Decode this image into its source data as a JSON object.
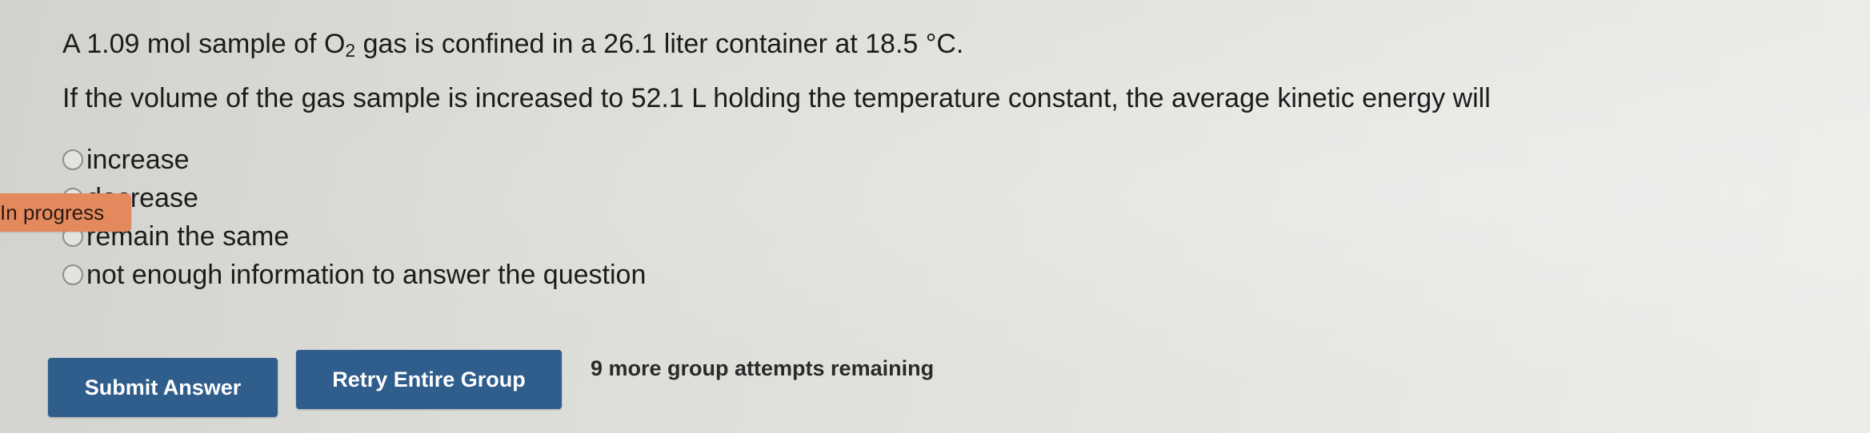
{
  "question": {
    "line1_prefix": "A 1.09 mol sample of O",
    "line1_subscript": "2",
    "line1_suffix": " gas is confined in a 26.1 liter container at 18.5 °C.",
    "line2": "If the volume of the gas sample is increased to 52.1 L holding the temperature constant, the average kinetic energy will"
  },
  "options": [
    {
      "label": "increase"
    },
    {
      "label": "decrease"
    },
    {
      "label": "remain the same"
    },
    {
      "label": "not enough information to answer the question"
    }
  ],
  "progress_badge": "In progress",
  "buttons": {
    "submit": "Submit Answer",
    "retry": "Retry Entire Group"
  },
  "attempts_text": "9 more group attempts remaining",
  "colors": {
    "button_bg": "#2f5d8c",
    "badge_bg": "#e3895d"
  }
}
